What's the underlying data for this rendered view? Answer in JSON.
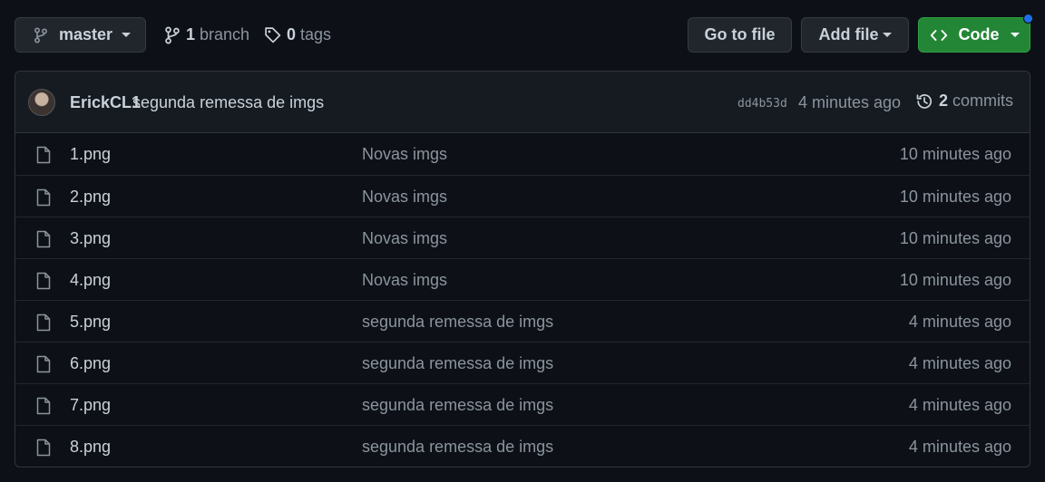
{
  "toolbar": {
    "branch_name": "master",
    "branches_count": "1",
    "branches_label": "branch",
    "tags_count": "0",
    "tags_label": "tags",
    "go_to_file": "Go to file",
    "add_file": "Add file",
    "code": "Code"
  },
  "latest_commit": {
    "author": "ErickCL1",
    "message": "segunda remessa de imgs",
    "sha": "dd4b53d",
    "time": "4 minutes ago",
    "commits_count": "2",
    "commits_label": "commits"
  },
  "files": [
    {
      "name": "1.png",
      "commit": "Novas imgs",
      "age": "10 minutes ago"
    },
    {
      "name": "2.png",
      "commit": "Novas imgs",
      "age": "10 minutes ago"
    },
    {
      "name": "3.png",
      "commit": "Novas imgs",
      "age": "10 minutes ago"
    },
    {
      "name": "4.png",
      "commit": "Novas imgs",
      "age": "10 minutes ago"
    },
    {
      "name": "5.png",
      "commit": "segunda remessa de imgs",
      "age": "4 minutes ago"
    },
    {
      "name": "6.png",
      "commit": "segunda remessa de imgs",
      "age": "4 minutes ago"
    },
    {
      "name": "7.png",
      "commit": "segunda remessa de imgs",
      "age": "4 minutes ago"
    },
    {
      "name": "8.png",
      "commit": "segunda remessa de imgs",
      "age": "4 minutes ago"
    }
  ],
  "icons": {
    "branch": "git-branch-icon",
    "tag": "tag-icon",
    "code": "code-brackets-icon",
    "history": "history-icon",
    "file": "file-icon"
  },
  "colors": {
    "background": "#0d1117",
    "header": "#161b22",
    "border": "#30363d",
    "button": "#21262d",
    "code_button": "#238636",
    "text": "#c9d1d9",
    "muted": "#8b949e",
    "notification_dot": "#1f6feb"
  }
}
